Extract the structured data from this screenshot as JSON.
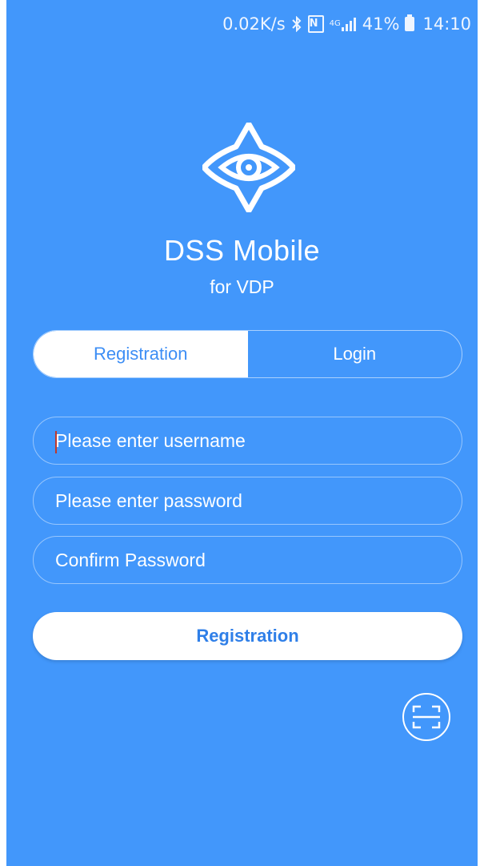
{
  "status_bar": {
    "speed": "0.02K/s",
    "network": "4G",
    "battery": "41%",
    "time": "14:10"
  },
  "app": {
    "title": "DSS Mobile",
    "subtitle": "for VDP"
  },
  "tabs": [
    {
      "label": "Registration",
      "active": true
    },
    {
      "label": "Login",
      "active": false
    }
  ],
  "form": {
    "username_placeholder": "Please enter username",
    "username_value": "",
    "password_placeholder": "Please enter password",
    "password_value": "",
    "confirm_placeholder": "Confirm Password",
    "confirm_value": ""
  },
  "submit_label": "Registration",
  "icons": {
    "logo": "eye-star-logo",
    "scan": "scan-icon"
  },
  "colors": {
    "background": "#4297fb",
    "accent_text": "#3d8ef5"
  }
}
